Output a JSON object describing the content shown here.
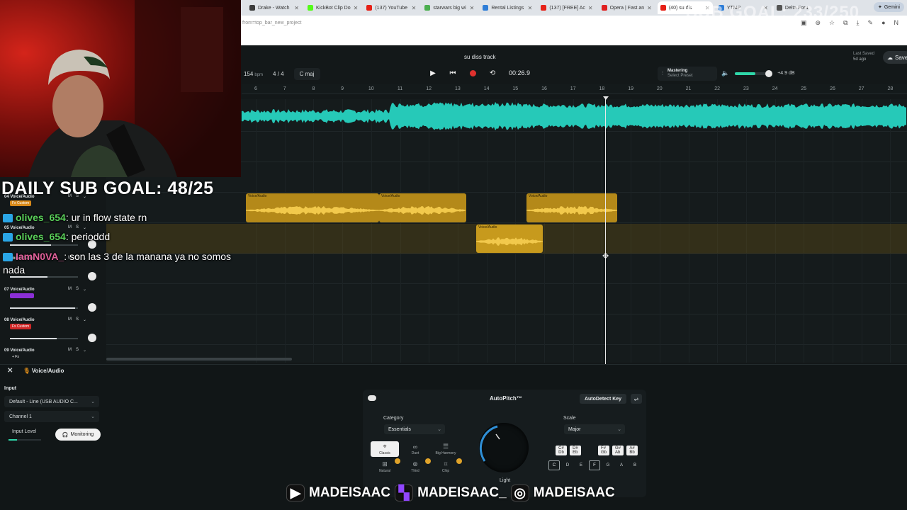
{
  "browser": {
    "tabs": [
      {
        "label": "Drake - Watch",
        "color": "#3c3c3c"
      },
      {
        "label": "KickBot Clip Do",
        "color": "#53fc18"
      },
      {
        "label": "(137) YouTube",
        "color": "#e62117"
      },
      {
        "label": "starwars big wi",
        "color": "#4caf50"
      },
      {
        "label": "Rental Listings",
        "color": "#2e7dd7"
      },
      {
        "label": "(137) [FREE] Ac",
        "color": "#e62117"
      },
      {
        "label": "Opera | Fast an",
        "color": "#e02020"
      },
      {
        "label": "(40) su dis",
        "color": "#e62117"
      },
      {
        "label": "YTMP",
        "color": "#2e7dd7"
      },
      {
        "label": "Delta Foru",
        "color": "#555555"
      }
    ],
    "gemini_label": "Gemini",
    "url": "from=top_bar_new_project"
  },
  "stream": {
    "sub_goal_big": "SUB GOAL: 233/250",
    "daily_goal": "DAILY SUB GOAL: 48/25",
    "chat": [
      {
        "user": "olives_654",
        "user_color": "#5ad05a",
        "message": "ur in flow state rn"
      },
      {
        "user": "olives_654",
        "user_color": "#5ad05a",
        "message": "perioddd"
      },
      {
        "user": "IamN0VA_",
        "user_color": "#e0609a",
        "message": "son las 3 de la manana ya no somos nada"
      }
    ],
    "socials": [
      "MADEISAAC",
      "MADEISAAC_",
      "MADEISAAC"
    ]
  },
  "daw": {
    "project_name": "su diss track",
    "last_saved_label": "Last Saved",
    "last_saved_value": "5d ago",
    "save_label": "Save",
    "bpm": "154",
    "bpm_unit": "bpm",
    "time_signature": "4 / 4",
    "key": "C maj",
    "timecode": "00:26.9",
    "mastering_label": "Mastering",
    "mastering_preset": "Select Preset",
    "volume_db": "+4.9 dB",
    "volume_level": 0.62,
    "ruler": [
      "6",
      "7",
      "8",
      "9",
      "10",
      "11",
      "12",
      "13",
      "14",
      "15",
      "16",
      "17",
      "18",
      "19",
      "20",
      "21",
      "22",
      "23",
      "24",
      "25",
      "26",
      "27",
      "28"
    ],
    "clip_label": "Voice/Audio",
    "colors": {
      "waveform": "#26c9b8",
      "clip": "#b48919",
      "accent": "#2fd6a8",
      "record": "#e0312e"
    }
  },
  "tracks": [
    {
      "name": "04  Voice/Audio",
      "fx": "Fx Custom",
      "fx_color": "#d98a1a",
      "ms": [
        "M",
        "S"
      ],
      "level": 0.85
    },
    {
      "name": "05  Voice/Audio",
      "fx": "",
      "fx_color": "#d98a1a",
      "ms": [
        "M",
        "S"
      ],
      "level": 0.6
    },
    {
      "name": "06  Voice/Audio",
      "fx": "",
      "fx_color": "#d98a1a",
      "ms": [
        "M",
        "S"
      ],
      "level": 0.55
    },
    {
      "name": "07  Voice/Audio",
      "fx": "",
      "fx_color": "#8b2fd6",
      "ms": [
        "M",
        "S"
      ],
      "level": 0.95
    },
    {
      "name": "08  Voice/Audio",
      "fx": "Fx Custom",
      "fx_color": "#d02828",
      "ms": [
        "M",
        "S"
      ],
      "level": 0.66
    },
    {
      "name": "09  Voice/Audio",
      "fx": "+ Fx",
      "fx_color": "#333a3d",
      "ms": [
        "M",
        "S"
      ],
      "level": 0.9
    }
  ],
  "panel": {
    "track_title": "Voice/Audio",
    "input_label": "Input",
    "input_device": "Default - Line (USB AUDIO C...",
    "channel": "Channel 1",
    "input_level_label": "Input Level",
    "monitoring_label": "Monitoring",
    "autopitch_title": "AutoPitch™",
    "autodetect_label": "AutoDetect Key",
    "category_label": "Category",
    "category_value": "Essentials",
    "scale_label": "Scale",
    "scale_value": "Major",
    "categories": [
      "Classic",
      "Duet",
      "Big Harmony",
      "Natural",
      "Third",
      "Chip"
    ],
    "knob_label": "Light",
    "keys_top": [
      "C#\nDb",
      "D#\nEb",
      "F#\nGb",
      "G#\nAb",
      "A#\nBb"
    ],
    "keys_bottom": [
      "C",
      "D",
      "E",
      "F",
      "G",
      "A",
      "B"
    ]
  }
}
